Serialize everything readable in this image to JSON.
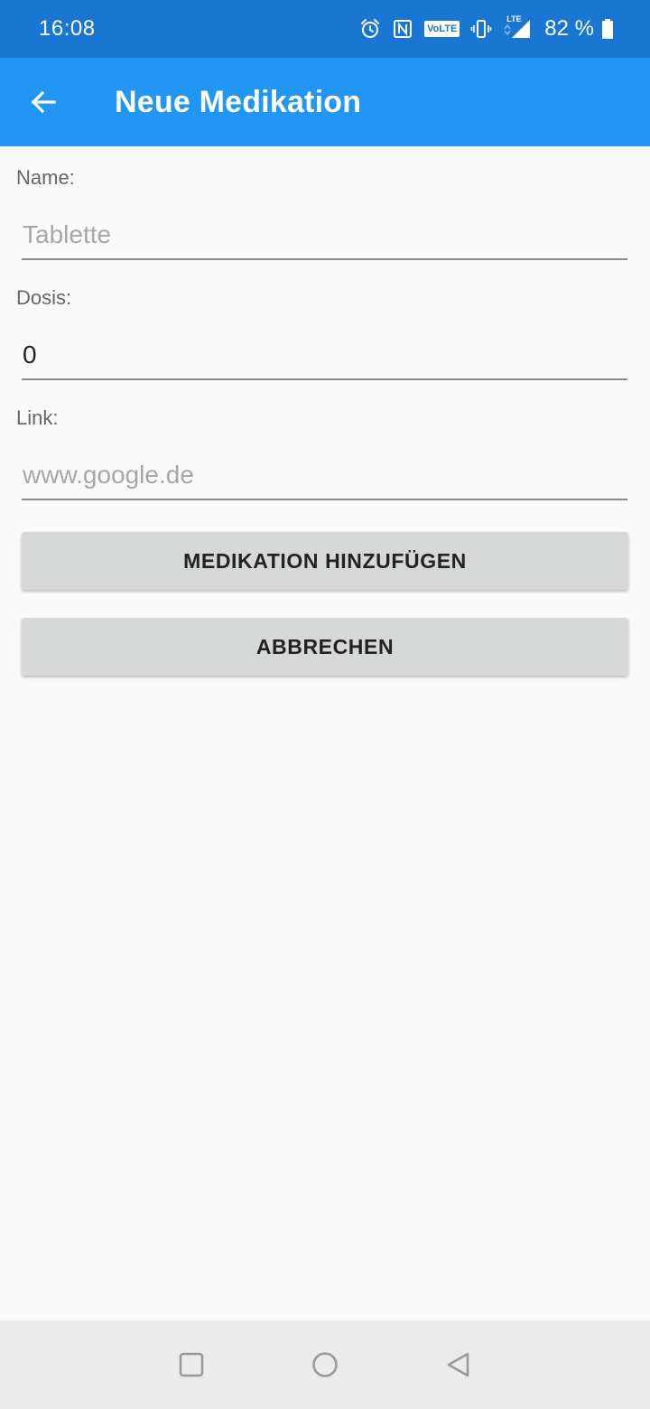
{
  "status_bar": {
    "time": "16:08",
    "battery_percent": "82 %",
    "network_label": "LTE",
    "volte_label": "VoLTE",
    "icons": [
      "alarm-icon",
      "nfc-icon",
      "volte-icon",
      "vibrate-icon",
      "signal-icon",
      "battery-icon"
    ]
  },
  "app_bar": {
    "title": "Neue Medikation",
    "back_icon": "arrow-left-icon",
    "background": "#2196f3"
  },
  "form": {
    "name_label": "Name:",
    "name_placeholder": "Tablette",
    "dose_label": "Dosis:",
    "dose_value": "0",
    "link_label": "Link:",
    "link_placeholder": "www.google.de"
  },
  "buttons": {
    "add_label": "MEDIKATION HINZUFÜGEN",
    "cancel_label": "ABBRECHEN"
  },
  "nav_bar": {
    "icons": [
      "recents-icon",
      "home-icon",
      "back-icon"
    ]
  }
}
